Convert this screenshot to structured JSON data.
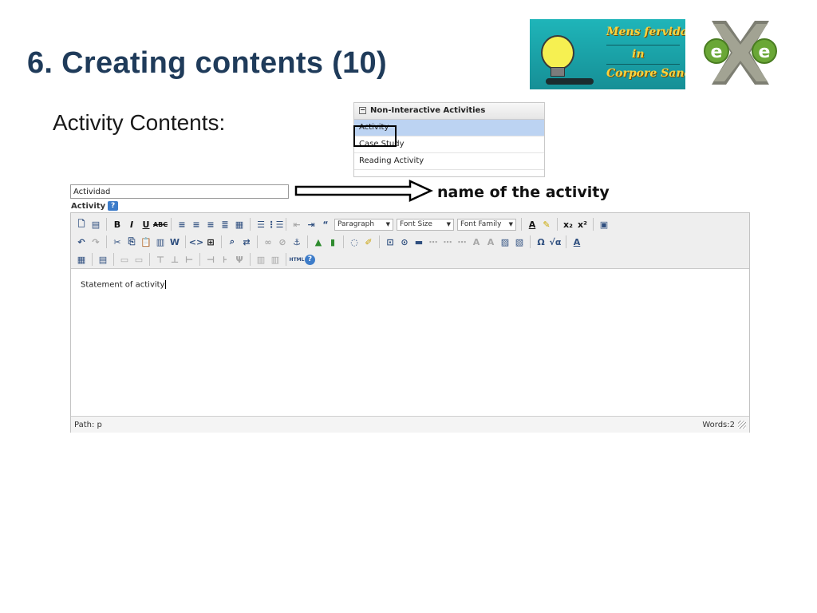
{
  "slide": {
    "title": "6. Creating contents (10)",
    "subtitle": "Activity Contents:"
  },
  "logos": {
    "mens_lines": [
      "Mens fervida",
      "in",
      "Corpore Sano"
    ],
    "exe_letters": [
      "e",
      "e"
    ]
  },
  "category_panel": {
    "header": "Non-Interactive Activities",
    "items": [
      "Activity",
      "Case Study",
      "Reading Activity"
    ],
    "selected": "Activity"
  },
  "name_field": {
    "value": "Actividad"
  },
  "callout": {
    "text": "name of the activity"
  },
  "editor": {
    "label": "Activity",
    "help_glyph": "?",
    "selects": {
      "paragraph": "Paragraph",
      "font_size": "Font Size",
      "font_family": "Font Family"
    },
    "content": "Statement of activity",
    "status_path": "Path: p",
    "status_words": "Words:2"
  },
  "toolbar_icons": {
    "row1": [
      "new-document-icon",
      "templates-icon",
      "bold-icon",
      "italic-icon",
      "underline-icon",
      "strikethrough-icon",
      "align-left-icon",
      "align-center-icon",
      "align-right-icon",
      "align-justify-icon",
      "styles-icon",
      "bullet-list-icon",
      "numbered-list-icon",
      "outdent-icon",
      "indent-icon",
      "blockquote-icon",
      "font-color-icon",
      "highlight-icon",
      "subscript-icon",
      "superscript-icon",
      "media-icon"
    ],
    "row2": [
      "undo-icon",
      "redo-icon",
      "cut-icon",
      "copy-icon",
      "paste-icon",
      "paste-text-icon",
      "paste-word-icon",
      "code-icon",
      "fullscreen-icon",
      "find-icon",
      "replace-icon",
      "link-icon",
      "unlink-icon",
      "anchor-icon",
      "image-icon",
      "video-icon",
      "cleanup-icon",
      "remove-format-icon",
      "abbr-icon",
      "advhr-icon",
      "hr-icon",
      "nonbreaking-icon",
      "pagebreak-icon",
      "visualchars-icon",
      "charmap-icon",
      "math-icon",
      "spellcheck-icon"
    ],
    "row3": [
      "table-icon",
      "table-props-icon",
      "row-icon",
      "cell-icon",
      "insert-row-icon",
      "delete-row-icon",
      "insert-col-icon",
      "merge-icon",
      "split-icon",
      "col-props-icon",
      "html-icon",
      "help-icon"
    ]
  }
}
